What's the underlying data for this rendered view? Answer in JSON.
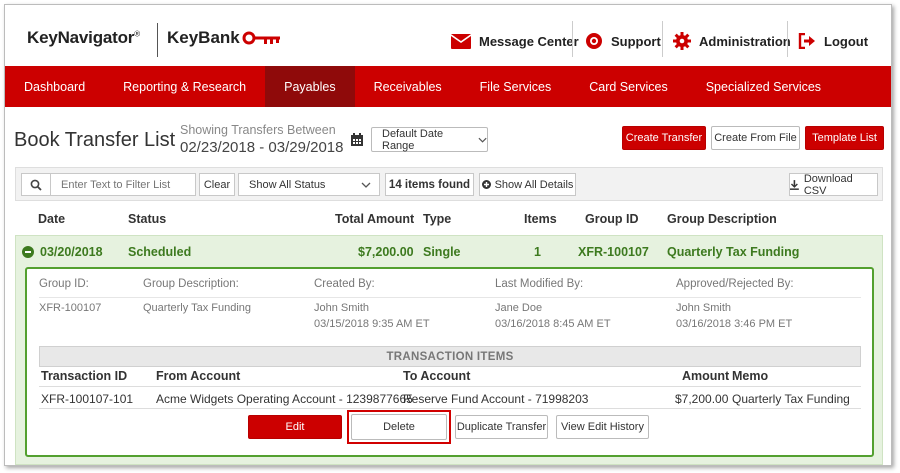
{
  "header": {
    "logo_keynavigator": "KeyNavigator",
    "logo_registered": "®",
    "logo_keybank": "KeyBank",
    "util": [
      {
        "label": "Message Center",
        "icon": "envelope-icon"
      },
      {
        "label": "Support",
        "icon": "lifebuoy-icon"
      },
      {
        "label": "Administration",
        "icon": "gear-icon"
      },
      {
        "label": "Logout",
        "icon": "logout-icon"
      }
    ]
  },
  "nav": {
    "items": [
      "Dashboard",
      "Reporting & Research",
      "Payables",
      "Receivables",
      "File Services",
      "Card Services",
      "Specialized Services"
    ],
    "active": "Payables"
  },
  "page": {
    "title": "Book Transfer List",
    "showing_label": "Showing Transfers Between",
    "date_range": "02/23/2018 - 03/29/2018",
    "date_dropdown": "Default Date Range",
    "create_transfer": "Create Transfer",
    "create_from_file": "Create From File",
    "template_list": "Template List"
  },
  "filter": {
    "placeholder": "Enter Text to Filter List",
    "clear": "Clear",
    "status": "Show All Status",
    "items_found": "14 items found",
    "show_all_details": "Show All Details",
    "download_csv": "Download CSV"
  },
  "table": {
    "headers": [
      "Date",
      "Status",
      "Total Amount",
      "Type",
      "Items",
      "Group ID",
      "Group Description"
    ],
    "row": {
      "date": "03/20/2018",
      "status": "Scheduled",
      "amount": "$7,200.00",
      "type": "Single",
      "items": "1",
      "group_id": "XFR-100107",
      "group_desc": "Quarterly Tax Funding"
    }
  },
  "detail": {
    "labels": {
      "group_id": "Group ID:",
      "group_desc": "Group Description:",
      "created_by": "Created By:",
      "last_modified": "Last Modified By:",
      "approved": "Approved/Rejected By:"
    },
    "values": {
      "group_id": "XFR-100107",
      "group_desc": "Quarterly Tax Funding",
      "created_name": "John Smith",
      "created_date": "03/15/2018 9:35 AM ET",
      "modified_name": "Jane Doe",
      "modified_date": "03/16/2018 8:45 AM ET",
      "approved_name": "John Smith",
      "approved_date": "03/16/2018 3:46 PM ET"
    },
    "items_title": "TRANSACTION ITEMS",
    "items_headers": [
      "Transaction ID",
      "From Account",
      "To Account",
      "Amount",
      "Memo"
    ],
    "item": {
      "id": "XFR-100107-101",
      "from": "Acme Widgets Operating Account - 1239877665",
      "to": "Reserve Fund Account - 71998203",
      "amount": "$7,200.00",
      "memo": "Quarterly Tax Funding"
    },
    "buttons": {
      "edit": "Edit",
      "delete": "Delete",
      "duplicate": "Duplicate Transfer",
      "history": "View Edit History"
    }
  },
  "colors": {
    "brand_red": "#cc0000",
    "nav_active": "#8f0a0a",
    "scheduled_green": "#3d7a1f",
    "row_bg": "#e6f2df"
  }
}
